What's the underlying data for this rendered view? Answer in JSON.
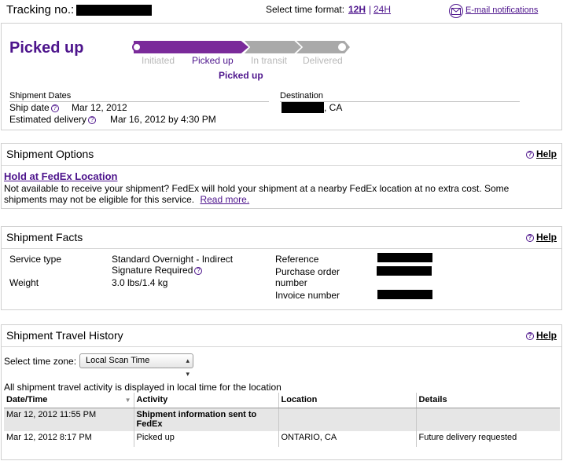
{
  "header": {
    "tracking_label": "Tracking no.:",
    "time_format_label": "Select time format:",
    "time_format_12h": "12H",
    "time_format_sep": "|",
    "time_format_24h": "24H",
    "email_link": "E-mail notifications"
  },
  "status": {
    "title": "Picked up",
    "progress_steps": [
      "Initiated",
      "Picked up",
      "In transit",
      "Delivered"
    ],
    "current_step": "Picked up",
    "current_step_index": 1,
    "shipment_dates_heading": "Shipment Dates",
    "destination_heading": "Destination",
    "ship_date_label": "Ship date",
    "ship_date_value": "Mar 12, 2012",
    "est_delivery_label": "Estimated delivery",
    "est_delivery_value": "Mar 16, 2012 by 4:30 PM",
    "destination_value": ", CA"
  },
  "options": {
    "title": "Shipment Options",
    "help": "Help",
    "hold_link": "Hold at FedEx Location",
    "hold_desc": "Not available to receive your shipment? FedEx will hold your shipment at a nearby FedEx location at no extra cost. Some shipments may not be eligible for this service.",
    "read_more": "Read more."
  },
  "facts": {
    "title": "Shipment Facts",
    "help": "Help",
    "service_type_label": "Service type",
    "service_type_value": "Standard Overnight - Indirect",
    "signature_value": "Signature Required",
    "weight_label": "Weight",
    "weight_value": "3.0 lbs/1.4 kg",
    "reference_label": "Reference",
    "po_label_1": "Purchase order",
    "po_label_2": "number",
    "invoice_label": "Invoice number"
  },
  "history": {
    "title": "Shipment Travel History",
    "help": "Help",
    "tz_label": "Select time zone:",
    "tz_value": "Local Scan Time",
    "note": "All shipment travel activity is displayed in local time for the location",
    "columns": [
      "Date/Time",
      "Activity",
      "Location",
      "Details"
    ],
    "rows": [
      {
        "datetime": "Mar 12, 2012 11:55 PM",
        "activity": "Shipment information sent to FedEx",
        "location": "",
        "details": ""
      },
      {
        "datetime": "Mar 12, 2012 8:17 PM",
        "activity": "Picked up",
        "location": "ONTARIO, CA",
        "details": "Future delivery requested"
      }
    ]
  },
  "colors": {
    "brand_purple": "#4d148c",
    "progress_purple": "#7a2a9a",
    "progress_grey": "#a9a9a9"
  }
}
